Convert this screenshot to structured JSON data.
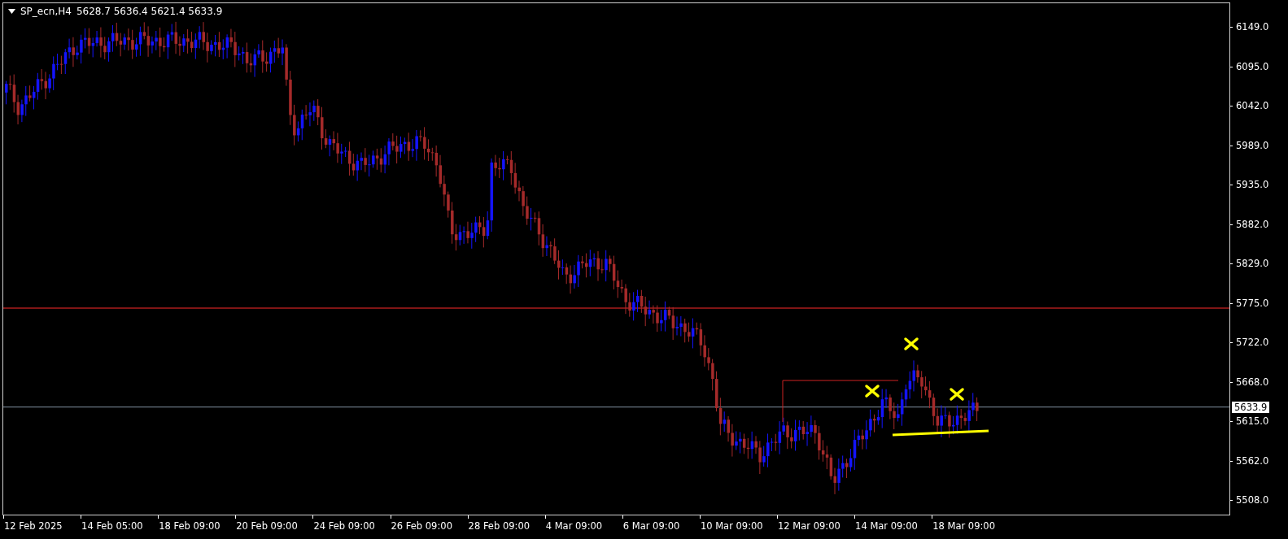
{
  "header": {
    "symbol": "SP_ecn,H4",
    "ohlc": "5628.7 5636.4 5621.4 5633.9"
  },
  "price_axis": [
    "6149.0",
    "6095.0",
    "6042.0",
    "5989.0",
    "5935.0",
    "5882.0",
    "5829.0",
    "5775.0",
    "5722.0",
    "5668.0",
    "5615.0",
    "5562.0",
    "5508.0"
  ],
  "current_price": "5633.9",
  "time_axis": [
    "12 Feb 2025",
    "14 Feb 05:00",
    "18 Feb 09:00",
    "20 Feb 09:00",
    "24 Feb 09:00",
    "26 Feb 09:00",
    "28 Feb 09:00",
    "4 Mar 09:00",
    "6 Mar 09:00",
    "10 Mar 09:00",
    "12 Mar 09:00",
    "14 Mar 09:00",
    "18 Mar 09:00"
  ]
}
